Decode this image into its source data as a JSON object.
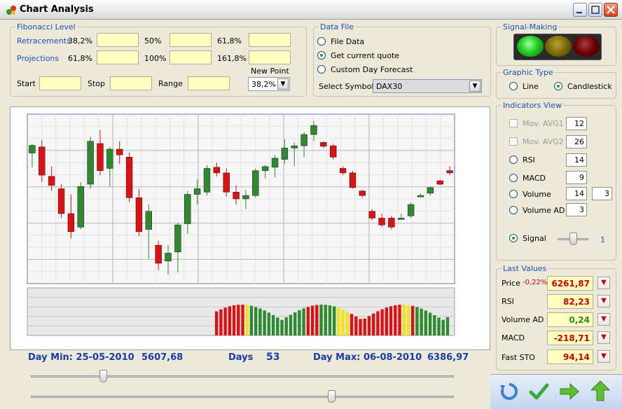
{
  "window": {
    "title": "Chart Analysis"
  },
  "fibonacci": {
    "title": "Fibonacci Level",
    "retracements_label": "Retracements",
    "retracements": [
      "38,2%",
      "50%",
      "61,8%"
    ],
    "projections_label": "Projections",
    "projections": [
      "61,8%",
      "100%",
      "161,8%"
    ],
    "start_label": "Start",
    "stop_label": "Stop",
    "range_label": "Range",
    "new_point_label": "New Point",
    "new_point_value": "38,2%"
  },
  "data_file": {
    "title": "Data File",
    "options": [
      "File Data",
      "Get current quote",
      "Custom Day Forecast"
    ],
    "selected": 1,
    "symbol_label": "Select Symbol",
    "symbol_value": "DAX30"
  },
  "signal_making": {
    "title": "Signal-Making",
    "lights": [
      "#22cc22",
      "#7a6a00",
      "#6a0000"
    ]
  },
  "graphic_type": {
    "title": "Graphic Type",
    "options": [
      "Line",
      "Candlestick"
    ],
    "selected": 1
  },
  "indicators": {
    "title": "Indicators View",
    "mov_avg1": {
      "label": "Mov. AVG1",
      "value": "12"
    },
    "mov_avg2": {
      "label": "Mov. AVG2",
      "value": "26"
    },
    "rsi": {
      "label": "RSI",
      "value": "14"
    },
    "macd": {
      "label": "MACD",
      "value": "9"
    },
    "volume": {
      "label": "Volume",
      "value": "14",
      "value2": "3"
    },
    "volume_ad": {
      "label": "Volume AD",
      "value": "3"
    },
    "signal": {
      "label": "Signal",
      "value": "1",
      "slider_level": 0.45
    }
  },
  "last_values": {
    "title": "Last Values",
    "price_label": "Price",
    "price_change": "-0,22%",
    "price": "6261,87",
    "rsi_label": "RSI",
    "rsi": "82,23",
    "volume_ad_label": "Volume AD",
    "volume_ad": "0,24",
    "macd_label": "MACD",
    "macd": "-218,71",
    "fast_sto_label": "Fast STO",
    "fast_sto": "94,14"
  },
  "info": {
    "day_min": "Day Min: 25-05-2010",
    "min_value": "5607,68",
    "days_label": "Days",
    "days": "53",
    "day_max": "Day Max: 06-08-2010",
    "max_value": "6386,97"
  },
  "sliders": {
    "top_level": 0.17,
    "bottom_level": 0.71
  },
  "colors": {
    "up": "#2f8a2f",
    "down": "#dd1111",
    "signal_yellow": "#f2e21a"
  },
  "chart_data": {
    "type": "candlestick",
    "candles": [
      [
        6148,
        6188,
        6085,
        6182
      ],
      [
        6175,
        6205,
        6020,
        6050
      ],
      [
        6045,
        6090,
        5980,
        6005
      ],
      [
        5990,
        6010,
        5860,
        5880
      ],
      [
        5880,
        5965,
        5770,
        5800
      ],
      [
        5820,
        6020,
        5810,
        6000
      ],
      [
        6010,
        6220,
        5990,
        6200
      ],
      [
        6190,
        6250,
        6050,
        6070
      ],
      [
        6080,
        6175,
        6000,
        6165
      ],
      [
        6165,
        6200,
        6100,
        6140
      ],
      [
        6130,
        6150,
        5930,
        5950
      ],
      [
        5950,
        5990,
        5780,
        5800
      ],
      [
        5810,
        5920,
        5680,
        5890
      ],
      [
        5740,
        5760,
        5630,
        5660
      ],
      [
        5670,
        5740,
        5610,
        5705
      ],
      [
        5710,
        5840,
        5620,
        5830
      ],
      [
        5835,
        5980,
        5790,
        5965
      ],
      [
        5965,
        6030,
        5920,
        5990
      ],
      [
        5975,
        6095,
        5960,
        6080
      ],
      [
        6085,
        6105,
        6045,
        6060
      ],
      [
        6060,
        6080,
        5955,
        5975
      ],
      [
        5975,
        6005,
        5920,
        5945
      ],
      [
        5945,
        5985,
        5900,
        5960
      ],
      [
        5960,
        6080,
        5950,
        6070
      ],
      [
        6070,
        6095,
        6035,
        6088
      ],
      [
        6085,
        6140,
        6040,
        6125
      ],
      [
        6120,
        6210,
        6100,
        6170
      ],
      [
        6170,
        6195,
        6090,
        6180
      ],
      [
        6180,
        6240,
        6130,
        6230
      ],
      [
        6230,
        6290,
        6200,
        6270
      ],
      [
        6195,
        6200,
        6170,
        6178
      ],
      [
        6180,
        6190,
        6120,
        6130
      ],
      [
        6080,
        6090,
        6050,
        6060
      ],
      [
        6060,
        6070,
        5990,
        5995
      ],
      [
        5980,
        5985,
        5950,
        5960
      ],
      [
        5890,
        5900,
        5850,
        5860
      ],
      [
        5860,
        5880,
        5820,
        5830
      ],
      [
        5860,
        5870,
        5810,
        5820
      ],
      [
        5855,
        5880,
        5855,
        5860
      ],
      [
        5870,
        5930,
        5860,
        5920
      ],
      [
        5960,
        5970,
        5955,
        5960
      ],
      [
        5970,
        6000,
        5960,
        5995
      ],
      [
        6025,
        6030,
        6005,
        6010
      ],
      [
        6070,
        6090,
        6050,
        6060
      ]
    ],
    "volume_signal": [
      "red",
      "red",
      "red",
      "red",
      "red",
      "red",
      "red",
      "yellow",
      "green",
      "green",
      "green",
      "green",
      "green",
      "green",
      "green",
      "green",
      "green",
      "green",
      "green",
      "green",
      "green",
      "red",
      "red",
      "red",
      "green",
      "green",
      "green",
      "green",
      "yellow",
      "yellow",
      "yellow",
      "red",
      "red",
      "red",
      "red",
      "red",
      "red",
      "red",
      "red",
      "red",
      "red",
      "red",
      "red",
      "yellow",
      "yellow",
      "red",
      "green",
      "green",
      "green",
      "green",
      "green",
      "green",
      "green",
      "green"
    ]
  }
}
